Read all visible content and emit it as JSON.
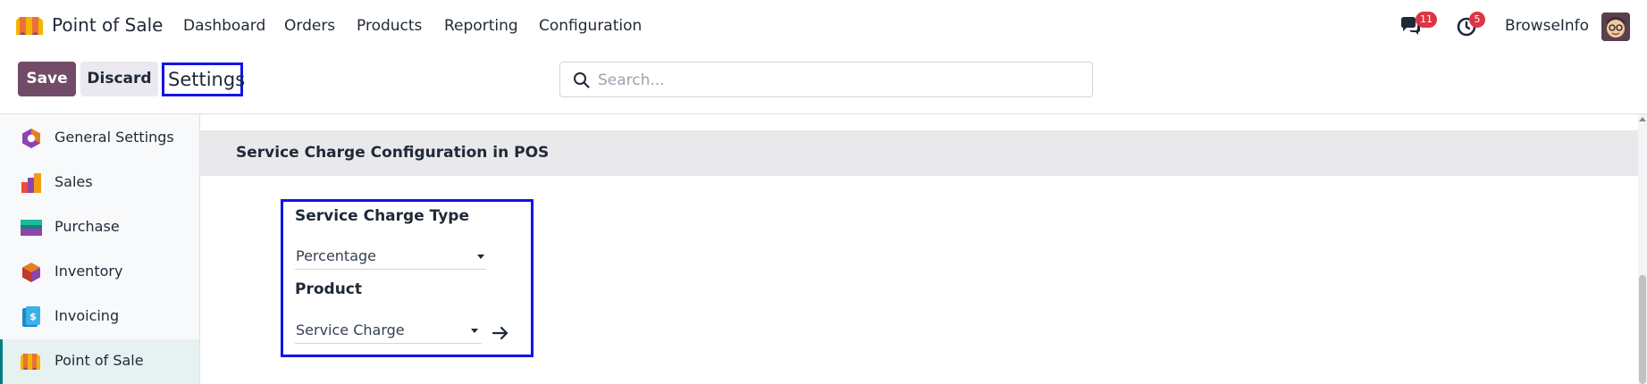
{
  "navbar": {
    "app_name": "Point of Sale",
    "menu": [
      "Dashboard",
      "Orders",
      "Products",
      "Reporting",
      "Configuration"
    ],
    "messages_count": "11",
    "activities_count": "5",
    "user_name": "BrowseInfo"
  },
  "control_panel": {
    "save_label": "Save",
    "discard_label": "Discard",
    "breadcrumb": "Settings",
    "search_placeholder": "Search..."
  },
  "sidebar": {
    "items": [
      {
        "label": "General Settings",
        "icon": "general-settings-icon"
      },
      {
        "label": "Sales",
        "icon": "sales-icon"
      },
      {
        "label": "Purchase",
        "icon": "purchase-icon"
      },
      {
        "label": "Inventory",
        "icon": "inventory-icon"
      },
      {
        "label": "Invoicing",
        "icon": "invoicing-icon"
      },
      {
        "label": "Point of Sale",
        "icon": "point-of-sale-icon",
        "active": true
      }
    ]
  },
  "section": {
    "title": "Service Charge Configuration in POS",
    "service_charge_type": {
      "label": "Service Charge Type",
      "value": "Percentage"
    },
    "product": {
      "label": "Product",
      "value": "Service Charge"
    }
  },
  "colors": {
    "brand": "#714b67",
    "highlight_border": "#1313e6",
    "badge": "#dc3545",
    "active_accent": "#017e84"
  }
}
